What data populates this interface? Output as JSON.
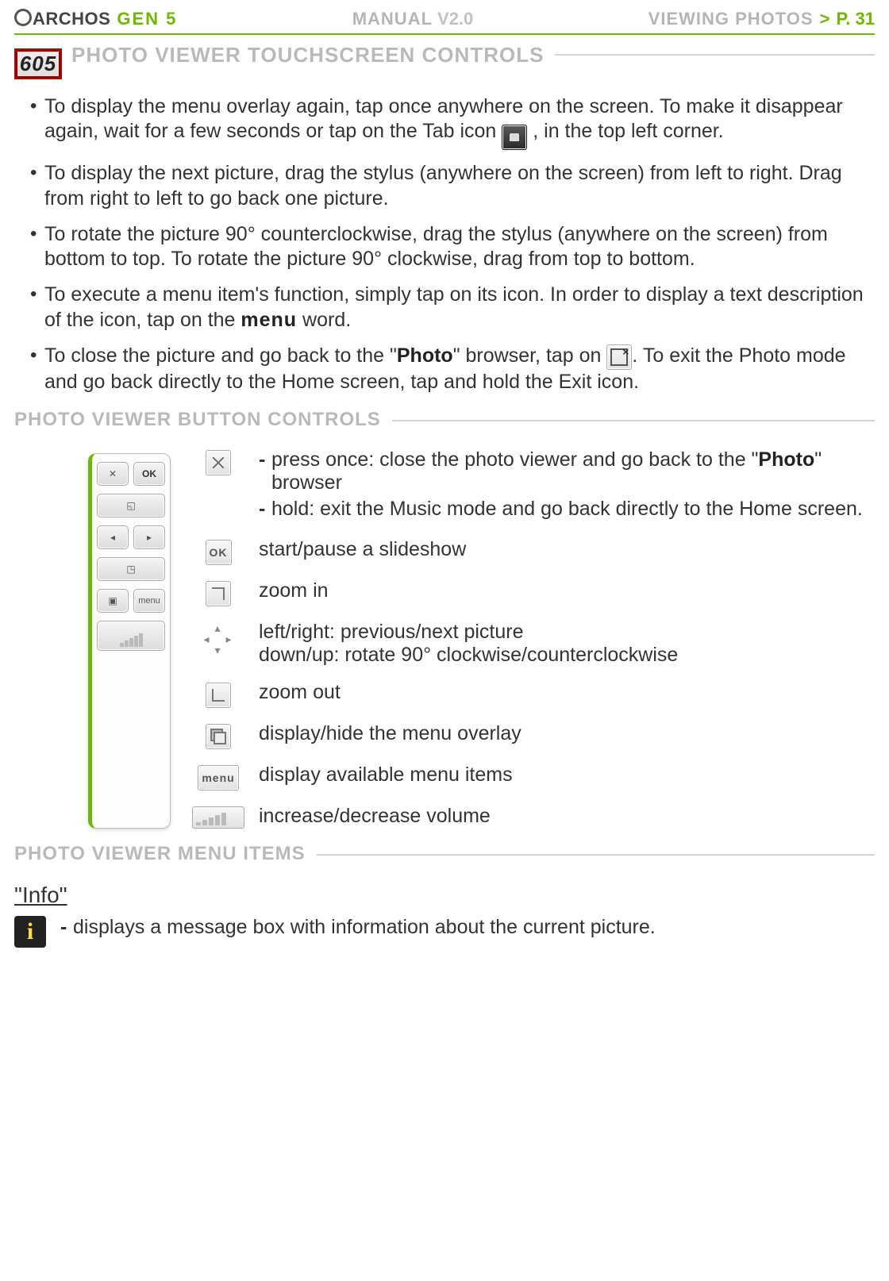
{
  "header": {
    "brand": "ARCHOS",
    "gen": "GEN 5",
    "manual_label": "MANUAL",
    "manual_version": "V2.0",
    "section_label": "VIEWING PHOTOS",
    "gt": ">",
    "page_label": "P. 31"
  },
  "section1": {
    "badge": "605",
    "title": "PHOTO VIEWER TOUCHSCREEN CONTROLS",
    "bullets": {
      "b1a": "To display the menu overlay again, tap once anywhere on the screen. To make it dis­appear again, wait for a few seconds or tap on the Tab icon ",
      "b1b": ", in the top left corner.",
      "b2": "To display the next picture, drag the stylus (anywhere on the screen) from left to right. Drag from right to left to go back one picture.",
      "b3": "To rotate the picture 90° counterclockwise, drag the stylus (anywhere on the screen) from bottom to top. To rotate the picture 90° clockwise, drag from top to bottom.",
      "b4a": "To execute a menu item's function, simply tap on its icon. In order to display a text description of the icon, tap on the ",
      "b4_menu": "menu",
      "b4b": " word.",
      "b5a": " To close the picture and go back to the \"",
      "b5_photo": "Photo",
      "b5b": "\" browser, tap on ",
      "b5c": ". To exit the Photo mode and go back directly to the Home screen, tap and hold the Exit icon."
    }
  },
  "section2": {
    "title": "PHOTO VIEWER BUTTON CONTROLS",
    "controls": {
      "close_press_a": "press once: close the photo viewer and go back to the \"",
      "close_press_photo": "Photo",
      "close_press_b": "\" browser",
      "close_hold": "hold: exit the Music mode and go back directly to the Home screen.",
      "ok_label": "OK",
      "ok_text": "start/pause a slideshow",
      "zoom_in": "zoom in",
      "arrows_line1": "left/right: previous/next picture",
      "arrows_line2": "down/up: rotate 90° clockwise/counterclockwise",
      "zoom_out": "zoom out",
      "overlay": "display/hide the menu overlay",
      "menu_label": "menu",
      "menu_text": "display available menu items",
      "volume": "increase/decrease volume"
    }
  },
  "section3": {
    "title": "PHOTO VIEWER MENU ITEMS",
    "info_label": "\"Info\"",
    "info_text": "displays a message box with information about the current picture."
  }
}
